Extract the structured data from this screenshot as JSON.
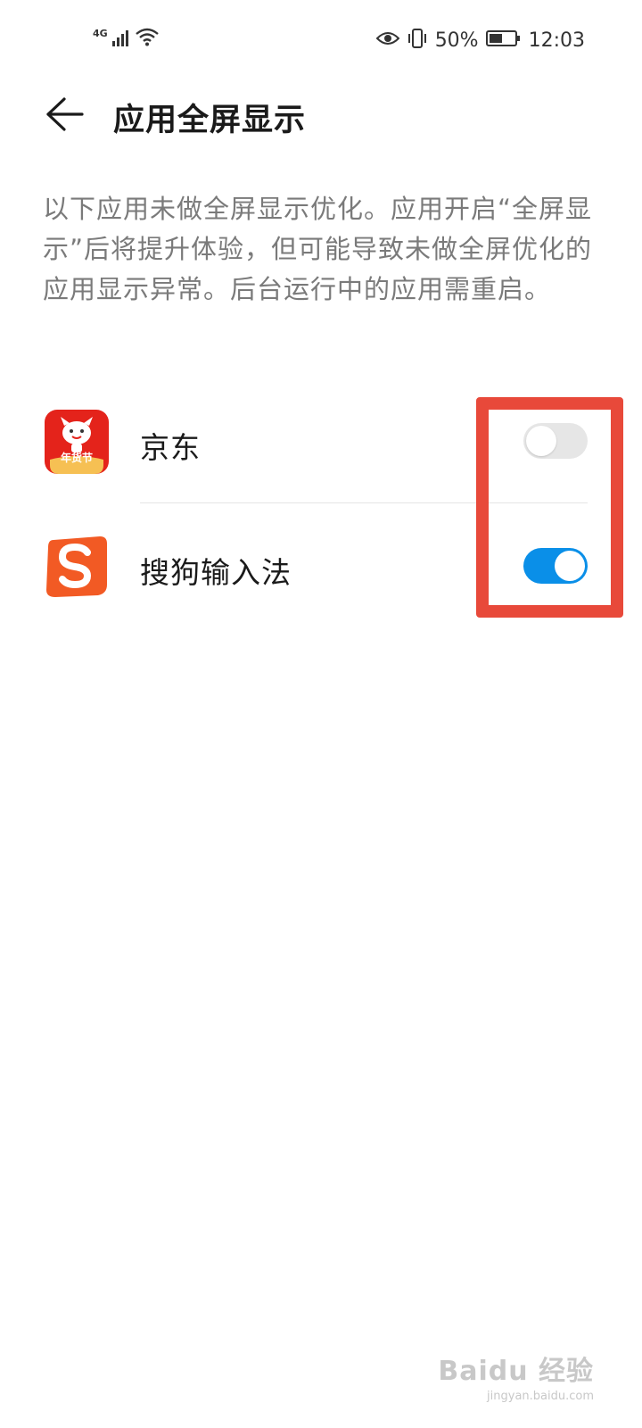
{
  "status_bar": {
    "network_type": "4G",
    "battery_percent": "50%",
    "time": "12:03",
    "icons": [
      "signal-icon",
      "wifi-icon",
      "eye-icon",
      "vibrate-icon",
      "battery-icon"
    ],
    "battery_level": 0.5
  },
  "header": {
    "title": "应用全屏显示",
    "back_icon": "arrow-left-icon"
  },
  "description": "以下应用未做全屏显示优化。应用开启“全屏显示”后将提升体验，但可能导致未做全屏优化的应用显示异常。后台运行中的应用需重启。",
  "apps": [
    {
      "name": "京东",
      "icon": "jd-app-icon",
      "icon_text": "年货节",
      "fullscreen_enabled": false
    },
    {
      "name": "搜狗输入法",
      "icon": "sogou-app-icon",
      "fullscreen_enabled": true
    }
  ],
  "colors": {
    "toggle_on": "#0a8fe8",
    "toggle_off": "#e6e6e6",
    "highlight": "#e8493a",
    "jd_red": "#e4231b",
    "sogou_orange": "#f25a24"
  },
  "watermark": {
    "main": "Baidu 经验",
    "sub": "jingyan.baidu.com"
  }
}
